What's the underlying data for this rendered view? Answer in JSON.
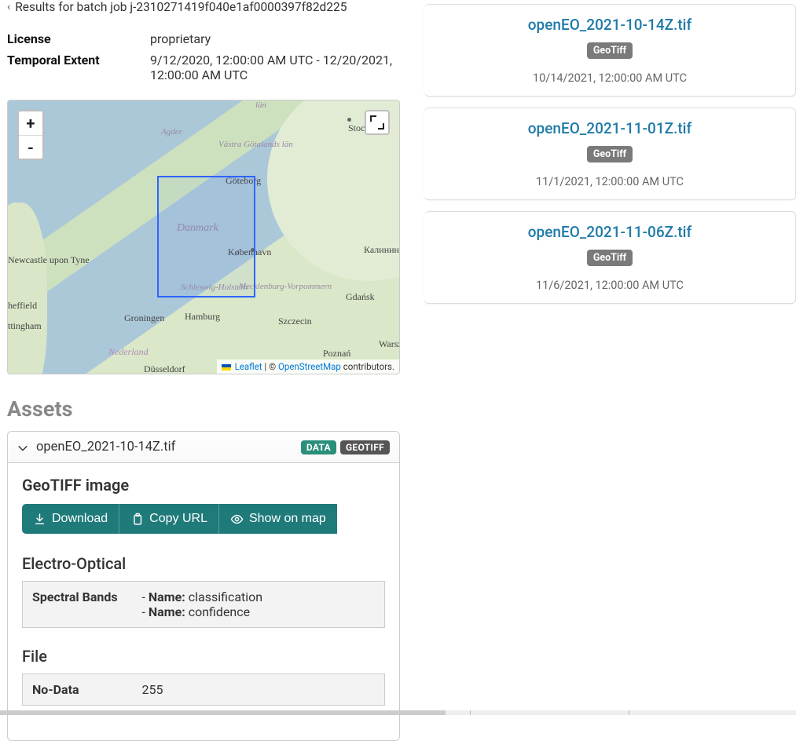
{
  "header": {
    "title_prefix": "Results for batch job",
    "job_id": "j-2310271419f040e1af0000397f82d225"
  },
  "metadata": {
    "license_label": "License",
    "license_value": "proprietary",
    "temporal_label": "Temporal Extent",
    "temporal_value": "9/12/2020, 12:00:00 AM UTC - 12/20/2021, 12:00:00 AM UTC"
  },
  "map": {
    "zoom_in": "+",
    "zoom_out": "-",
    "labels": {
      "danmark": "Danmark",
      "kobenhavn": "København",
      "goteborg": "Göteborg",
      "stockholm": "Stockholm",
      "hamburg": "Hamburg",
      "groningen": "Groningen",
      "nederland": "Nederland",
      "dusseldorf": "Düsseldorf",
      "szczecin": "Szczecin",
      "gdansk": "Gdańsk",
      "poznan": "Poznań",
      "warsz": "Warsz",
      "kalinin": "Калинин",
      "newcastle": "Newcastle upon Tyne",
      "sheffield": "heffield",
      "nottingham": "ttingham",
      "schleswig": "Schleswig-Holstein",
      "mecklenburg": "Mecklenburg-Vorpommern",
      "vastra": "Västra Götalands län",
      "agder": "Agder",
      "lan": "län"
    },
    "attrib": {
      "leaflet": "Leaflet",
      "sep": " | © ",
      "osm": "OpenStreetMap",
      "tail": " contributors."
    }
  },
  "assets": {
    "heading": "Assets",
    "name": "openEO_2021-10-14Z.tif",
    "badge_data": "DATA",
    "badge_geotiff": "GEOTIFF",
    "body": {
      "title": "GeoTIFF image",
      "download": "Download",
      "copy_url": "Copy URL",
      "show_on_map": "Show on map",
      "eo_heading": "Electro-Optical",
      "spectral_label": "Spectral Bands",
      "band_name_label": "Name:",
      "band1": "classification",
      "band2": "confidence",
      "file_heading": "File",
      "nodata_label": "No-Data",
      "nodata_value": "255"
    }
  },
  "results": [
    {
      "title": "openEO_2021-10-14Z.tif",
      "chip": "GeoTiff",
      "date": "10/14/2021, 12:00:00 AM UTC"
    },
    {
      "title": "openEO_2021-11-01Z.tif",
      "chip": "GeoTiff",
      "date": "11/1/2021, 12:00:00 AM UTC"
    },
    {
      "title": "openEO_2021-11-06Z.tif",
      "chip": "GeoTiff",
      "date": "11/6/2021, 12:00:00 AM UTC"
    }
  ]
}
